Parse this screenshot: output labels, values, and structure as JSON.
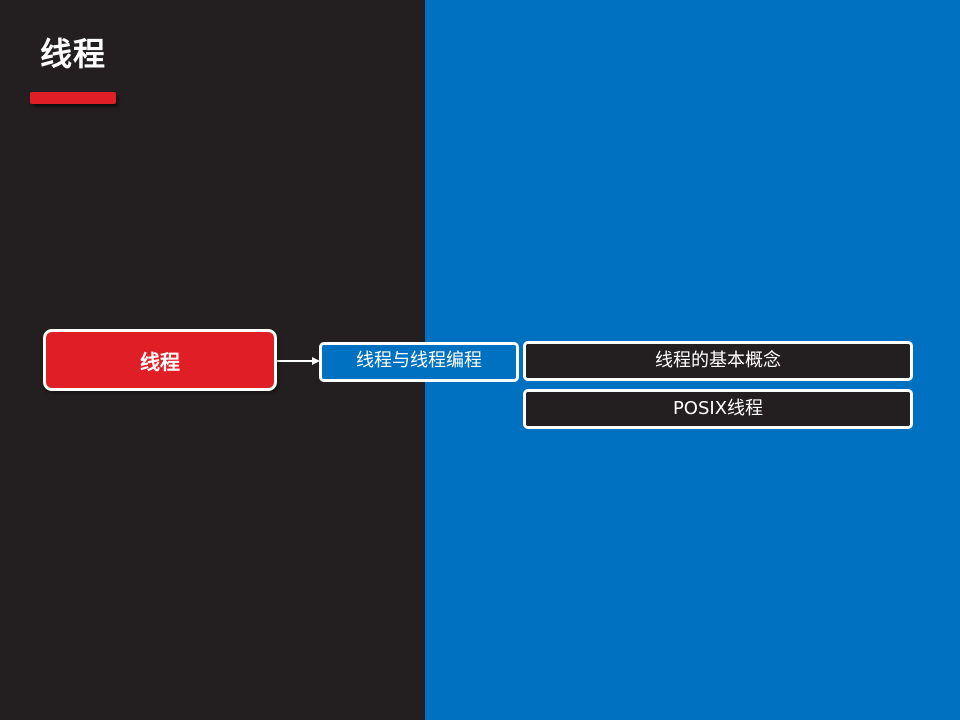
{
  "slide": {
    "title": "线程",
    "colors": {
      "left_panel": "#231f20",
      "right_panel": "#0070c0",
      "accent_red": "#e01e26",
      "leaf_fill": "#231f20",
      "mid_fill": "#0070c0",
      "border": "#ffffff"
    }
  },
  "diagram": {
    "root": {
      "label": "线程"
    },
    "branch": {
      "label": "线程与线程编程"
    },
    "leaves": [
      {
        "label": "线程的基本概念"
      },
      {
        "label": "POSIX线程"
      }
    ]
  }
}
